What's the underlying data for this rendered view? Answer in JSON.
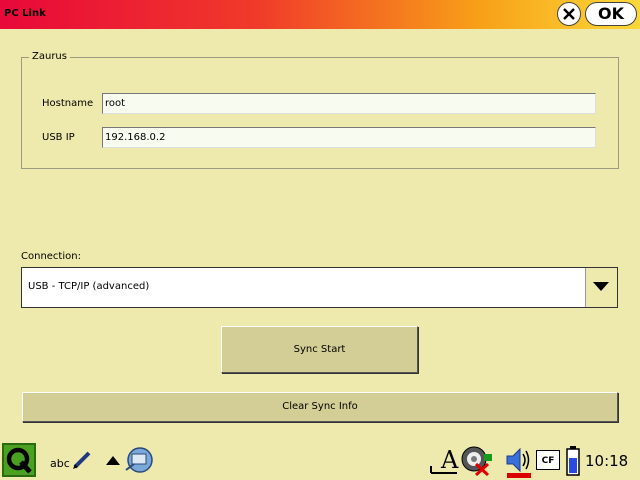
{
  "window": {
    "title": "PC Link",
    "ok_label": "OK"
  },
  "zaurus": {
    "group_label": "Zaurus",
    "hostname_label": "Hostname",
    "hostname_value": "root",
    "usbip_label": "USB IP",
    "usbip_value": "192.168.0.2"
  },
  "connection": {
    "label": "Connection:",
    "selected": "USB - TCP/IP (advanced)"
  },
  "buttons": {
    "sync_start": "Sync Start",
    "clear_sync_info": "Clear Sync Info"
  },
  "taskbar": {
    "input_method": "abc",
    "cf_label": "CF",
    "time": "10:18",
    "icons": [
      "qtopia-q-icon",
      "handwriting-input-icon",
      "up-arrow-icon",
      "applet-icon",
      "keyboard-a-icon",
      "network-disconnected-icon",
      "volume-icon",
      "cf-card-icon",
      "battery-icon"
    ]
  },
  "colors": {
    "background": "#eeeaae",
    "titlebar_start": "#e8083a",
    "titlebar_end": "#fcd838",
    "button_face": "#d2ce96"
  }
}
